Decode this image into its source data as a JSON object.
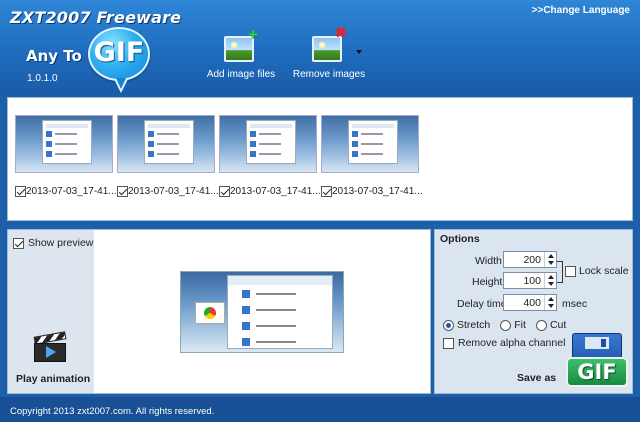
{
  "header": {
    "title": "ZXT2007 Freeware",
    "brand_anyto": "Any To",
    "brand_gif": "GIF",
    "version": "1.0.1.0",
    "change_language": ">>Change Language",
    "add_images": "Add image files",
    "remove_images": "Remove images"
  },
  "thumbnails": [
    {
      "label": "2013-07-03_17-41...",
      "checked": true
    },
    {
      "label": "2013-07-03_17-41...",
      "checked": true
    },
    {
      "label": "2013-07-03_17-41...",
      "checked": true
    },
    {
      "label": "2013-07-03_17-41...",
      "checked": true
    }
  ],
  "preview": {
    "show_preview": "Show preview",
    "show_preview_checked": true,
    "play_animation": "Play animation"
  },
  "options": {
    "title": "Options",
    "width_label": "Width",
    "width_value": "200",
    "height_label": "Height",
    "height_value": "100",
    "lock_scale": "Lock scale",
    "lock_scale_checked": false,
    "delay_label": "Delay time",
    "delay_value": "400",
    "delay_unit": "msec",
    "mode_options": [
      "Stretch",
      "Fit",
      "Cut"
    ],
    "mode_selected": "Stretch",
    "remove_alpha": "Remove alpha channel",
    "remove_alpha_checked": false,
    "save_as": "Save as",
    "save_gif": "GIF"
  },
  "footer": {
    "copyright": "Copyright 2013 zxt2007.com. All rights reserved."
  },
  "colors": {
    "header_blue": "#1f6cbe",
    "footer_blue": "#184f95",
    "panel_bg": "#dbe5f0"
  }
}
